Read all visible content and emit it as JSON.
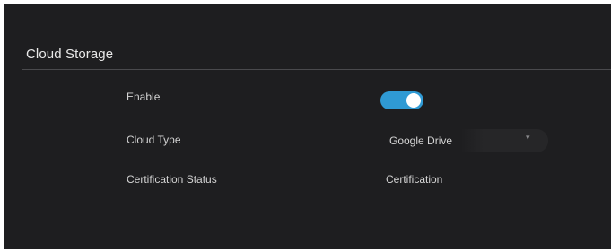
{
  "section": {
    "title": "Cloud Storage"
  },
  "settings": {
    "enable": {
      "label": "Enable",
      "on": true
    },
    "cloud_type": {
      "label": "Cloud Type",
      "value": "Google Drive",
      "arrow_icon": "chevron-down-icon"
    },
    "certification_status": {
      "label": "Certification Status",
      "value": "Certification"
    }
  },
  "colors": {
    "background": "#1e1e20",
    "accent": "#2f9ad4",
    "text": "#d4d4d4"
  }
}
